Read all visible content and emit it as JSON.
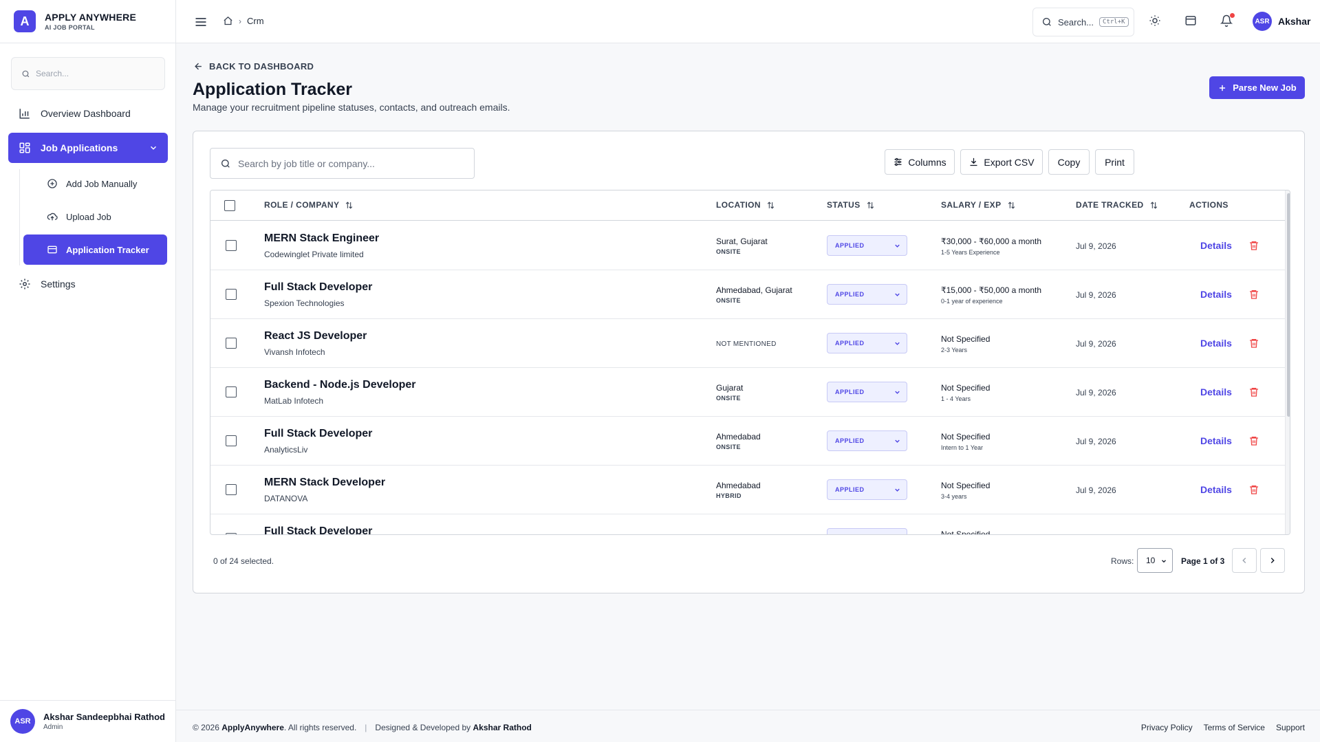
{
  "brand": {
    "logo_letter": "A",
    "name": "APPLY ANYWHERE",
    "subtitle": "AI JOB PORTAL"
  },
  "sidebar": {
    "search_placeholder": "Search...",
    "items": [
      {
        "label": "Overview Dashboard",
        "icon": "bar-chart-icon"
      },
      {
        "label": "Job Applications",
        "icon": "grid-icon",
        "expanded": true
      },
      {
        "label": "Settings",
        "icon": "gear-icon"
      }
    ],
    "sub_items": [
      {
        "label": "Add Job Manually",
        "icon": "plus-circle-icon"
      },
      {
        "label": "Upload Job",
        "icon": "cloud-upload-icon"
      },
      {
        "label": "Application Tracker",
        "icon": "card-icon",
        "active": true
      }
    ],
    "user": {
      "initials": "ASR",
      "name": "Akshar Sandeepbhai Rathod",
      "role": "Admin"
    }
  },
  "topbar": {
    "breadcrumb": "Crm",
    "search_label": "Search...",
    "search_shortcut": "Ctrl+K",
    "user_initials": "ASR",
    "user_name": "Akshar"
  },
  "page": {
    "back_label": "BACK TO DASHBOARD",
    "title": "Application Tracker",
    "subtitle": "Manage your recruitment pipeline statuses, contacts, and outreach emails.",
    "primary_button": "Parse New Job"
  },
  "toolbar": {
    "search_placeholder": "Search by job title or company...",
    "columns_label": "Columns",
    "export_label": "Export CSV",
    "copy_label": "Copy",
    "print_label": "Print"
  },
  "table": {
    "headers": {
      "role": "ROLE / COMPANY",
      "location": "LOCATION",
      "status": "STATUS",
      "salary": "SALARY / EXP",
      "date": "DATE TRACKED",
      "actions": "ACTIONS"
    },
    "details_label": "Details",
    "rows": [
      {
        "role": "MERN Stack Engineer",
        "company": "Codewinglet Private limited",
        "location": "Surat, Gujarat",
        "work_type": "ONSITE",
        "status": "APPLIED",
        "salary": "₹30,000 - ₹60,000 a month",
        "experience": "1-5 Years Experience",
        "date": "Jul 9, 2026"
      },
      {
        "role": "Full Stack Developer",
        "company": "Spexion Technologies",
        "location": "Ahmedabad, Gujarat",
        "work_type": "ONSITE",
        "status": "APPLIED",
        "salary": "₹15,000 - ₹50,000 a month",
        "experience": "0-1 year of experience",
        "date": "Jul 9, 2026"
      },
      {
        "role": "React JS Developer",
        "company": "Vivansh Infotech",
        "location": "",
        "work_type": "NOT MENTIONED",
        "status": "APPLIED",
        "salary": "Not Specified",
        "experience": "2-3 Years",
        "date": "Jul 9, 2026"
      },
      {
        "role": "Backend - Node.js Developer",
        "company": "MatLab Infotech",
        "location": "Gujarat",
        "work_type": "ONSITE",
        "status": "APPLIED",
        "salary": "Not Specified",
        "experience": "1 - 4 Years",
        "date": "Jul 9, 2026"
      },
      {
        "role": "Full Stack Developer",
        "company": "AnalyticsLiv",
        "location": "Ahmedabad",
        "work_type": "ONSITE",
        "status": "APPLIED",
        "salary": "Not Specified",
        "experience": "Intern to 1 Year",
        "date": "Jul 9, 2026"
      },
      {
        "role": "MERN Stack Developer",
        "company": "DATANOVA",
        "location": "Ahmedabad",
        "work_type": "HYBRID",
        "status": "APPLIED",
        "salary": "Not Specified",
        "experience": "3-4 years",
        "date": "Jul 9, 2026"
      },
      {
        "role": "Full Stack Developer",
        "company": "",
        "location": "",
        "work_type": "",
        "status": "",
        "salary": "Not Specified",
        "experience": "",
        "date": ""
      }
    ]
  },
  "pagination": {
    "selected_text": "0 of 24 selected.",
    "rows_label": "Rows:",
    "rows_value": "10",
    "page_text": "Page 1 of 3"
  },
  "footer": {
    "copyright_prefix": "© 2026",
    "copyright_brand": "ApplyAnywhere",
    "copyright_suffix": ". All rights reserved.",
    "credit_prefix": "Designed & Developed by",
    "credit_name": "Akshar Rathod",
    "links": [
      "Privacy Policy",
      "Terms of Service",
      "Support"
    ]
  },
  "colors": {
    "accent": "#4f46e5",
    "danger": "#ef4444",
    "notification": "#ef4444"
  }
}
